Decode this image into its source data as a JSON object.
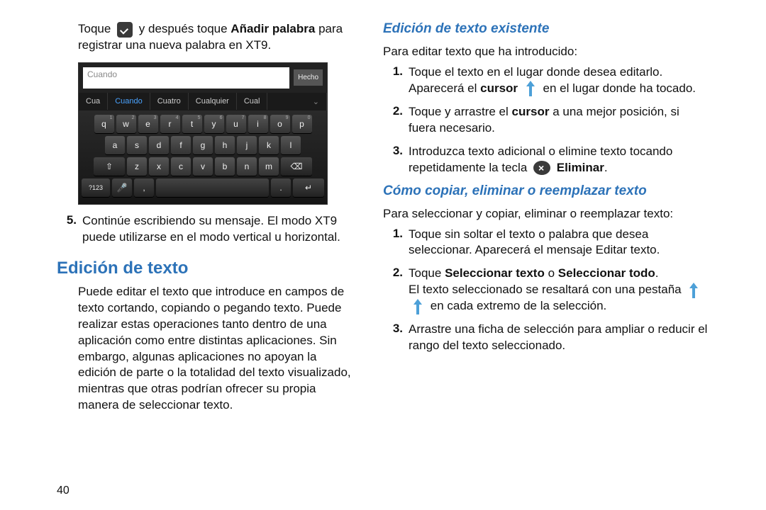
{
  "page_number": "40",
  "left": {
    "intro": {
      "pre": "Toque",
      "mid": "y después toque",
      "bold": "Añadir palabra",
      "post": "para registrar una nueva palabra en XT9."
    },
    "keyboard": {
      "input_value": "Cuando",
      "done": "Hecho",
      "suggestions": [
        "Cua",
        "Cuando",
        "Cuatro",
        "Cualquier",
        "Cual"
      ],
      "row1": [
        [
          "q",
          "1"
        ],
        [
          "w",
          "2"
        ],
        [
          "e",
          "3"
        ],
        [
          "r",
          "4"
        ],
        [
          "t",
          "5"
        ],
        [
          "y",
          "6"
        ],
        [
          "u",
          "7"
        ],
        [
          "i",
          "8"
        ],
        [
          "o",
          "9"
        ],
        [
          "p",
          "0"
        ]
      ],
      "row2": [
        "a",
        "s",
        "d",
        "f",
        "g",
        "h",
        "j",
        "k",
        "l"
      ],
      "row3_shift": "⇧",
      "row3": [
        "z",
        "x",
        "c",
        "v",
        "b",
        "n",
        "m"
      ],
      "row3_back": "⌫",
      "row4": {
        "sym": "?123",
        "mic": "🎤",
        "comma": ",",
        "dot": ".",
        "enter": "↵"
      }
    },
    "step5": {
      "num": "5.",
      "text": "Continúe escribiendo su mensaje. El modo XT9 puede utilizarse en el modo vertical u horizontal."
    },
    "h2": "Edición de texto",
    "para": "Puede editar el texto que introduce en campos de texto cortando, copiando o pegando texto. Puede realizar estas operaciones tanto dentro de una aplicación como entre distintas aplicaciones. Sin embargo, algunas aplicaciones no apoyan la edición de parte o la totalidad del texto visualizado, mientras que otras podrían ofrecer su propia manera de seleccionar texto."
  },
  "right": {
    "h3a": "Edición de texto existente",
    "intro_a": "Para editar texto que ha introducido:",
    "a1_pre": "Toque el texto en el lugar donde desea editarlo. Aparecerá el",
    "a1_bold": "cursor",
    "a1_post": "en el lugar donde ha tocado.",
    "a2_pre": "Toque y arrastre el",
    "a2_bold": "cursor",
    "a2_post": "a una mejor posición, si fuera necesario.",
    "a3_pre": "Introduzca texto adicional o elimine texto tocando repetidamente la tecla",
    "a3_bold": "Eliminar",
    "h3b": "Cómo copiar, eliminar o reemplazar texto",
    "intro_b": "Para seleccionar y copiar, eliminar o reemplazar texto:",
    "b1": "Toque sin soltar el texto o palabra que desea seleccionar. Aparecerá el mensaje Editar texto.",
    "b2_pre": "Toque",
    "b2_b1": "Seleccionar texto",
    "b2_mid": "o",
    "b2_b2": "Seleccionar todo",
    "b2_post1": "El texto seleccionado se resaltará con una pestaña",
    "b2_post2": "en cada extremo de la selección.",
    "b3": "Arrastre una ficha de selección para ampliar o reducir el rango del texto seleccionado."
  }
}
